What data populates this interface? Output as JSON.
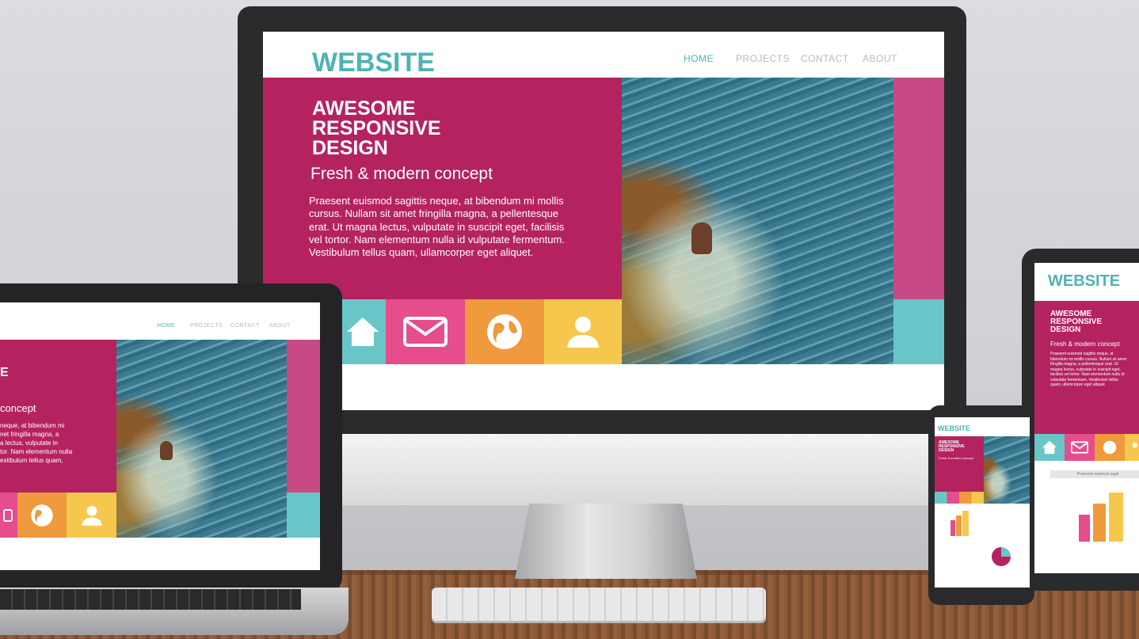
{
  "site": {
    "logo": "WEBSITE",
    "nav": [
      {
        "label": "HOME",
        "active": true
      },
      {
        "label": "PROJECTS",
        "active": false
      },
      {
        "label": "CONTACT",
        "active": false
      },
      {
        "label": "ABOUT",
        "active": false
      }
    ],
    "hero_title": "AWESOME\nRESPONSIVE\nDESIGN",
    "hero_subtitle": "Fresh & modern concept",
    "hero_body": "Praesent euismod sagittis neque, at bibendum mi mollis cursus. Nullam sit amet fringilla magna, a pellentesque erat. Ut magna lectus, vulputate in suscipit eget, facilisis vel tortor. Nam elementum nulla id vulputate fermentum. Vestibulum tellus quam, ullamcorper eget aliquet.",
    "tiles": [
      {
        "icon": "home-icon",
        "color": "#69c6c8"
      },
      {
        "icon": "mail-icon",
        "color": "#e54d8c"
      },
      {
        "icon": "globe-icon",
        "color": "#ef9a3c"
      },
      {
        "icon": "user-icon",
        "color": "#f5c84d"
      }
    ]
  },
  "laptop": {
    "nav": [
      "HOME",
      "PROJECTS",
      "CONTACT",
      "ABOUT"
    ],
    "title_fragment": "E",
    "subtitle_fragment": "concept",
    "body_fragment": "neque, at bibendum mi\nnet fringilla magna, a\na lectus, vulputate in\ntor. Nam elementum nulla\nestibulum tellus quam,"
  },
  "phone": {
    "logo": "WEBSITE",
    "hero_title": "AWESOME\nRESPONSIVE\nDESIGN",
    "hero_subtitle": "Fresh & modern concept"
  },
  "tablet": {
    "logo": "WEBSITE",
    "hero_title": "AWESOME\nRESPONSIVE\nDESIGN",
    "hero_subtitle": "Fresh & modern concept",
    "hero_body": "Praesent euismod sagittis neque, at bibendum mi mollis cursus. Nullam sit amet fringilla magna, a pellentesque erat. Ut magna lectus, vulputate in suscipit eget, facilisis vel tortor. Nam elementum nulla id vulputate fermentum. Vestibulum tellus quam, ullamcorper eget aliquet.",
    "caption": "Praesent euismod sagit"
  },
  "colors": {
    "brand_teal": "#4fb3b3",
    "hero_magenta": "#b42360",
    "tile_cyan": "#69c6c8",
    "tile_pink": "#e54d8c",
    "tile_orange": "#ef9a3c",
    "tile_yellow": "#f5c84d"
  }
}
